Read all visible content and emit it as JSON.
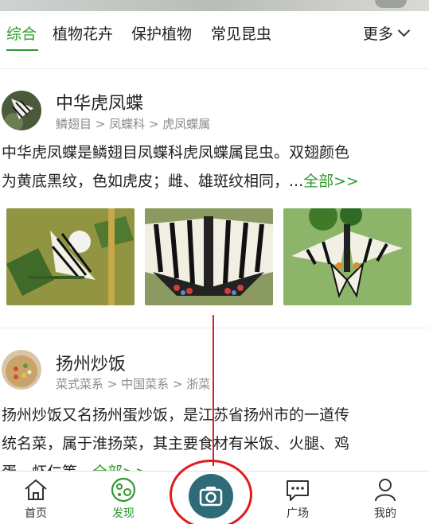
{
  "tabs": {
    "items": [
      {
        "label": "综合"
      },
      {
        "label": "植物花卉"
      },
      {
        "label": "保护植物"
      },
      {
        "label": "常见昆虫"
      }
    ],
    "more_label": "更多"
  },
  "cards": [
    {
      "title": "中华虎凤蝶",
      "breadcrumb": "鳞翅目 > 凤蝶科 > 虎凤蝶属",
      "description_line1": "中华虎凤蝶是鳞翅目凤蝶科虎凤蝶属昆虫。双翅颜色",
      "description_line2": "为黄底黑纹，色如虎皮；雌、雄斑纹相同，",
      "ellipsis": "...",
      "more_link": "全部>>"
    },
    {
      "title": "扬州炒饭",
      "breadcrumb": "菜式菜系 > 中国菜系 > 浙菜",
      "description_line1": "扬州炒饭又名扬州蛋炒饭，是江苏省扬州市的一道传",
      "description_line2": "统名菜，属于淮扬菜，其主要食材有米饭、火腿、鸡",
      "description_line3": "蛋、虾仁等，",
      "more_link": "全部>>"
    }
  ],
  "bottom_nav": {
    "items": [
      {
        "label": "首页",
        "icon": "home-icon"
      },
      {
        "label": "发现",
        "icon": "discover-icon"
      },
      {
        "label": "",
        "icon": "camera-icon"
      },
      {
        "label": "广场",
        "icon": "chat-icon"
      },
      {
        "label": "我的",
        "icon": "profile-icon"
      }
    ]
  },
  "colors": {
    "accent": "#2e9a2e",
    "camera": "#2f6a78",
    "annotation": "#e01b1b"
  }
}
